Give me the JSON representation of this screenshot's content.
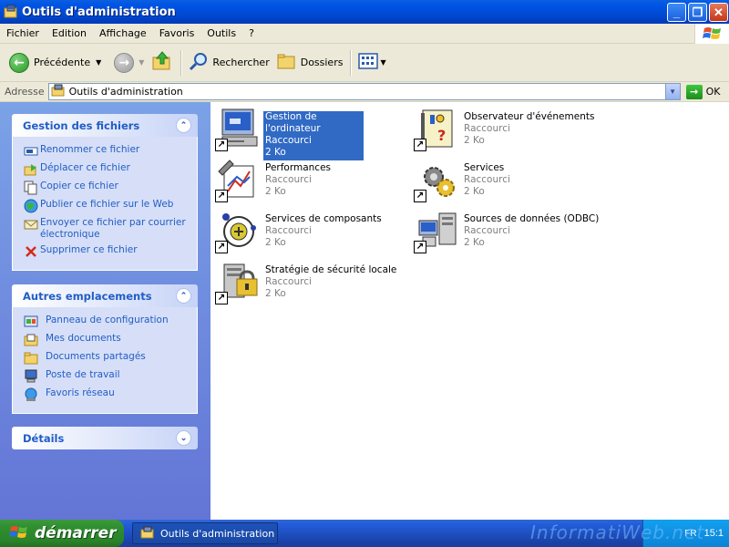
{
  "window": {
    "title": "Outils d'administration",
    "controls": {
      "minimize": "_",
      "maximize": "❐",
      "close": "✕"
    }
  },
  "menu": [
    "Fichier",
    "Edition",
    "Affichage",
    "Favoris",
    "Outils",
    "?"
  ],
  "toolbar": {
    "back_label": "Précédente",
    "search_label": "Rechercher",
    "folders_label": "Dossiers"
  },
  "address": {
    "label": "Adresse",
    "value": "Outils d'administration",
    "go_label": "OK"
  },
  "taskpane": {
    "file_tasks": {
      "title": "Gestion des fichiers",
      "items": [
        "Renommer ce fichier",
        "Déplacer ce fichier",
        "Copier ce fichier",
        "Publier ce fichier sur le Web",
        "Envoyer ce fichier par courrier électronique",
        "Supprimer ce fichier"
      ]
    },
    "other_places": {
      "title": "Autres emplacements",
      "items": [
        "Panneau de configuration",
        "Mes documents",
        "Documents partagés",
        "Poste de travail",
        "Favoris réseau"
      ]
    },
    "details": {
      "title": "Détails"
    }
  },
  "files": [
    {
      "name": "Gestion de l'ordinateur",
      "type": "Raccourci",
      "size": "2 Ko",
      "selected": true,
      "icon": "computer-management-icon"
    },
    {
      "name": "Observateur d'événements",
      "type": "Raccourci",
      "size": "2 Ko",
      "icon": "event-viewer-icon"
    },
    {
      "name": "Performances",
      "type": "Raccourci",
      "size": "2 Ko",
      "icon": "performance-icon"
    },
    {
      "name": "Services",
      "type": "Raccourci",
      "size": "2 Ko",
      "icon": "services-icon"
    },
    {
      "name": "Services de composants",
      "type": "Raccourci",
      "size": "2 Ko",
      "icon": "component-services-icon"
    },
    {
      "name": "Sources de données (ODBC)",
      "type": "Raccourci",
      "size": "2 Ko",
      "icon": "odbc-icon"
    },
    {
      "name": "Stratégie de sécurité locale",
      "type": "Raccourci",
      "size": "2 Ko",
      "icon": "local-security-policy-icon"
    }
  ],
  "taskbar": {
    "start_label": "démarrer",
    "window_button": "Outils d'administration",
    "tray_lang": "FR",
    "clock": "15:1",
    "watermark": "InformatiWeb.net"
  },
  "colors": {
    "title_blue": "#0055e5",
    "pane_blue": "#6375d6",
    "link_blue": "#215dc6",
    "selection": "#316ac5",
    "start_green": "#2f8e2f"
  }
}
